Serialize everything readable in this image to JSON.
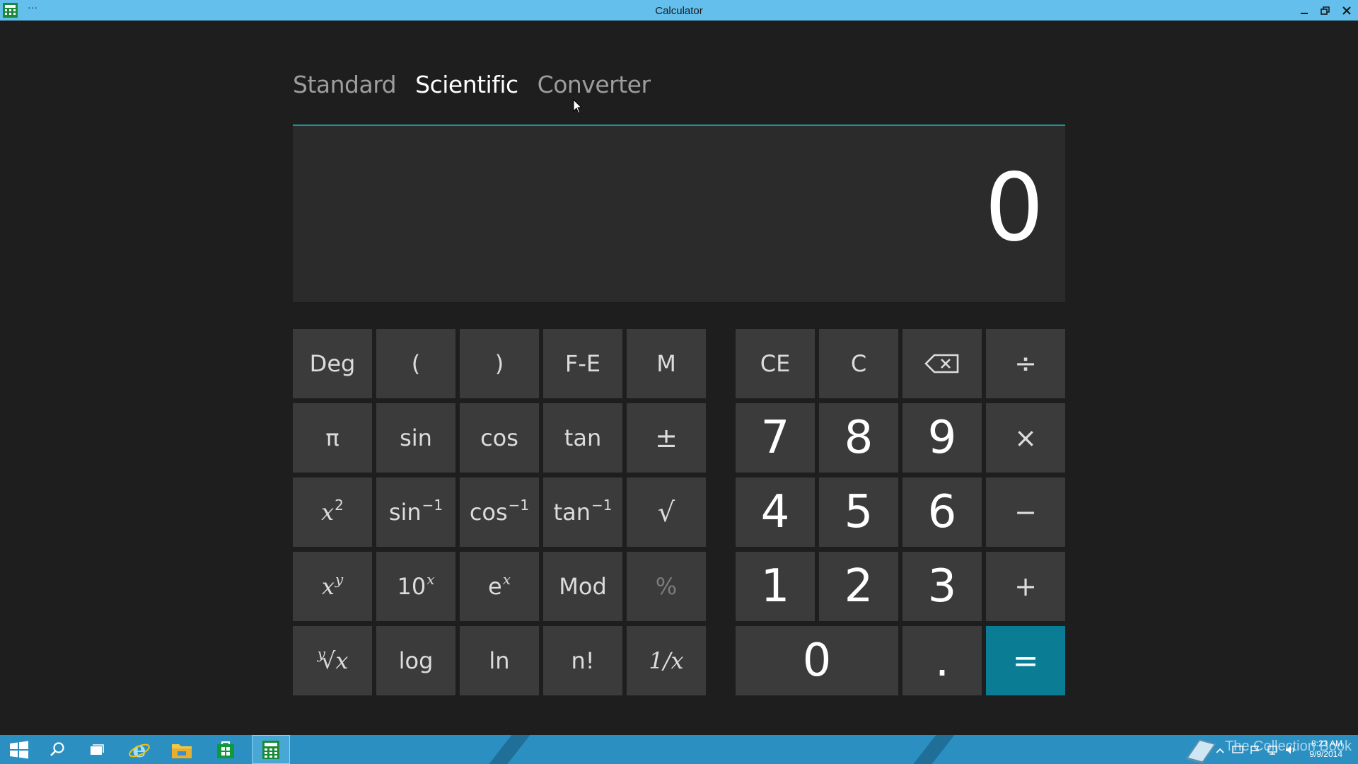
{
  "window": {
    "title": "Calculator",
    "menu_dots": "···"
  },
  "tabs": [
    {
      "label": "Standard",
      "active": false
    },
    {
      "label": "Scientific",
      "active": true
    },
    {
      "label": "Converter",
      "active": false
    }
  ],
  "display": {
    "value": "0"
  },
  "sci_keys": {
    "deg": "Deg",
    "lparen": "(",
    "rparen": ")",
    "fe": "F-E",
    "m": "M",
    "pi": "π",
    "sin": "sin",
    "cos": "cos",
    "tan": "tan",
    "plusminus": "±",
    "square_base": "x",
    "square_exp": "2",
    "asin_base": "sin",
    "asin_exp": "−1",
    "acos_base": "cos",
    "acos_exp": "−1",
    "atan_base": "tan",
    "atan_exp": "−1",
    "sqrt": "√",
    "pow_base": "x",
    "pow_exp": "y",
    "tenpow_base": "10",
    "tenpow_exp": "x",
    "exp_base": "e",
    "exp_exp": "x",
    "mod": "Mod",
    "percent": "%",
    "root_index": "y",
    "root_sign": "√",
    "root_x": "x",
    "log": "log",
    "ln": "ln",
    "factorial": "n!",
    "reciprocal": "1/x"
  },
  "num_keys": {
    "ce": "CE",
    "c": "C",
    "divide": "÷",
    "n7": "7",
    "n8": "8",
    "n9": "9",
    "multiply": "×",
    "n4": "4",
    "n5": "5",
    "n6": "6",
    "minus": "−",
    "n1": "1",
    "n2": "2",
    "n3": "3",
    "plus": "+",
    "n0": "0",
    "dot": ".",
    "equals": "="
  },
  "taskbar": {
    "watermark": "The Collection Book",
    "time": "8:23 AM",
    "date": "9/9/2014"
  },
  "colors": {
    "titlebar": "#64bfec",
    "accent": "#0a7d94",
    "taskbar": "#2b8fc1"
  }
}
